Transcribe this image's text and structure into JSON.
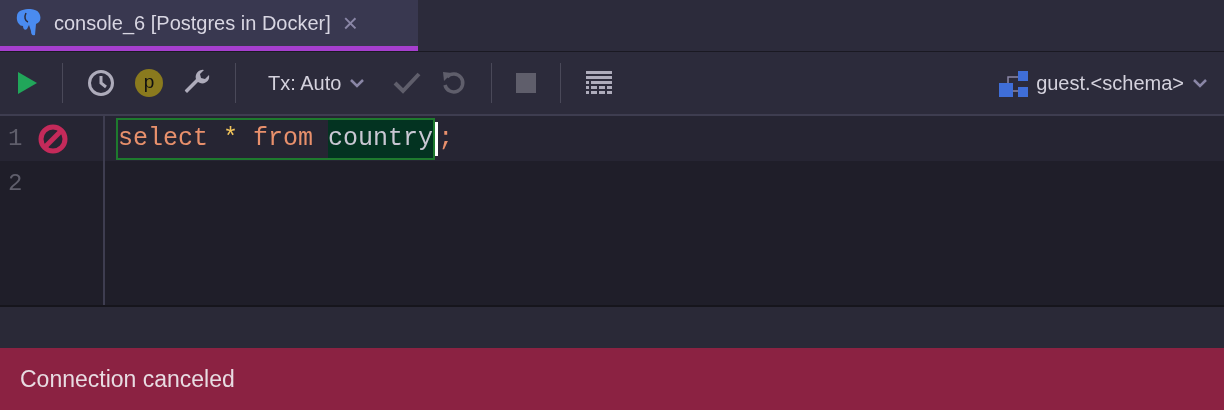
{
  "tab": {
    "title": "console_6 [Postgres in Docker]",
    "close": "×",
    "selected": true
  },
  "toolbar": [
    {
      "kind": "run",
      "disabled": false
    },
    {
      "kind": "divider"
    },
    {
      "kind": "history",
      "disabled": false
    },
    {
      "kind": "badge",
      "label": "p"
    },
    {
      "kind": "settings",
      "disabled": false
    },
    {
      "kind": "divider"
    },
    {
      "kind": "dropdown",
      "label": "Tx: Auto"
    },
    {
      "kind": "commit",
      "disabled": true
    },
    {
      "kind": "rollback",
      "disabled": true
    },
    {
      "kind": "divider"
    },
    {
      "kind": "stop",
      "disabled": true
    },
    {
      "kind": "divider"
    },
    {
      "kind": "table",
      "disabled": false
    }
  ],
  "schema": {
    "label": "guest.<schema>"
  },
  "editor": {
    "lines": [
      {
        "number": "1",
        "error": true,
        "statement": [
          {
            "kind": "keyword",
            "text": "select"
          },
          {
            "kind": "operator",
            "text": "*"
          },
          {
            "kind": "keyword",
            "text": "from"
          },
          {
            "kind": "identifier",
            "text": "country",
            "selected": true
          }
        ],
        "terminator": ";"
      },
      {
        "number": "2",
        "error": false
      }
    ]
  },
  "status": {
    "message": "Connection canceled"
  }
}
